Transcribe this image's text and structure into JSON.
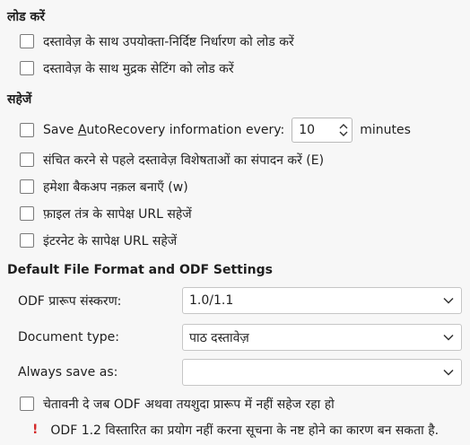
{
  "load": {
    "title": "लोड करें",
    "items": [
      {
        "label": "दस्तावेज़ के साथ उपयोक्ता-निर्दिष्ट निर्धारण को लोड करें",
        "checked": false
      },
      {
        "label": "दस्तावेज़ के साथ मुद्रक सेटिंग को लोड करें",
        "checked": false
      }
    ]
  },
  "save": {
    "title": "सहेजें",
    "autorecovery": {
      "label_pre": "Save ",
      "label_access": "A",
      "label_post": "utoRecovery information every:",
      "value": "10",
      "unit": "minutes",
      "checked": false
    },
    "items": [
      {
        "label": "संचित करने से पहले दस्तावेज़ विशेषताओं का संपादन करें (E)",
        "checked": false
      },
      {
        "label": "हमेशा बैकअप नक़ल बनाएँ (w)",
        "checked": false
      },
      {
        "label": "फ़ाइल तंत्र के सापेक्ष URL सहेजें",
        "checked": false
      },
      {
        "label": "इंटरनेट के सापेक्ष URL सहेजें",
        "checked": false
      }
    ]
  },
  "formats": {
    "title": "Default File Format and ODF Settings",
    "odf_version": {
      "label": "ODF प्रारूप संस्करण:",
      "value": "1.0/1.1"
    },
    "document_type": {
      "label": "Document type:",
      "value": "पाठ दस्तावेज़"
    },
    "always_save_as": {
      "label": "Always save as:",
      "value": ""
    },
    "warn_not_odf": {
      "label": "चेतावनी दे जब ODF अथवा तयशुदा प्रारूप में नहीं सहेज रहा हो",
      "checked": false
    },
    "warning_icon": "!",
    "warning_text": "ODF 1.2 विस्तारित का प्रयोग नहीं करना सूचना के नष्ट होने का कारण बन सकता है."
  },
  "colors": {
    "warning": "#d42a2a",
    "background": "#f7f7f7"
  }
}
